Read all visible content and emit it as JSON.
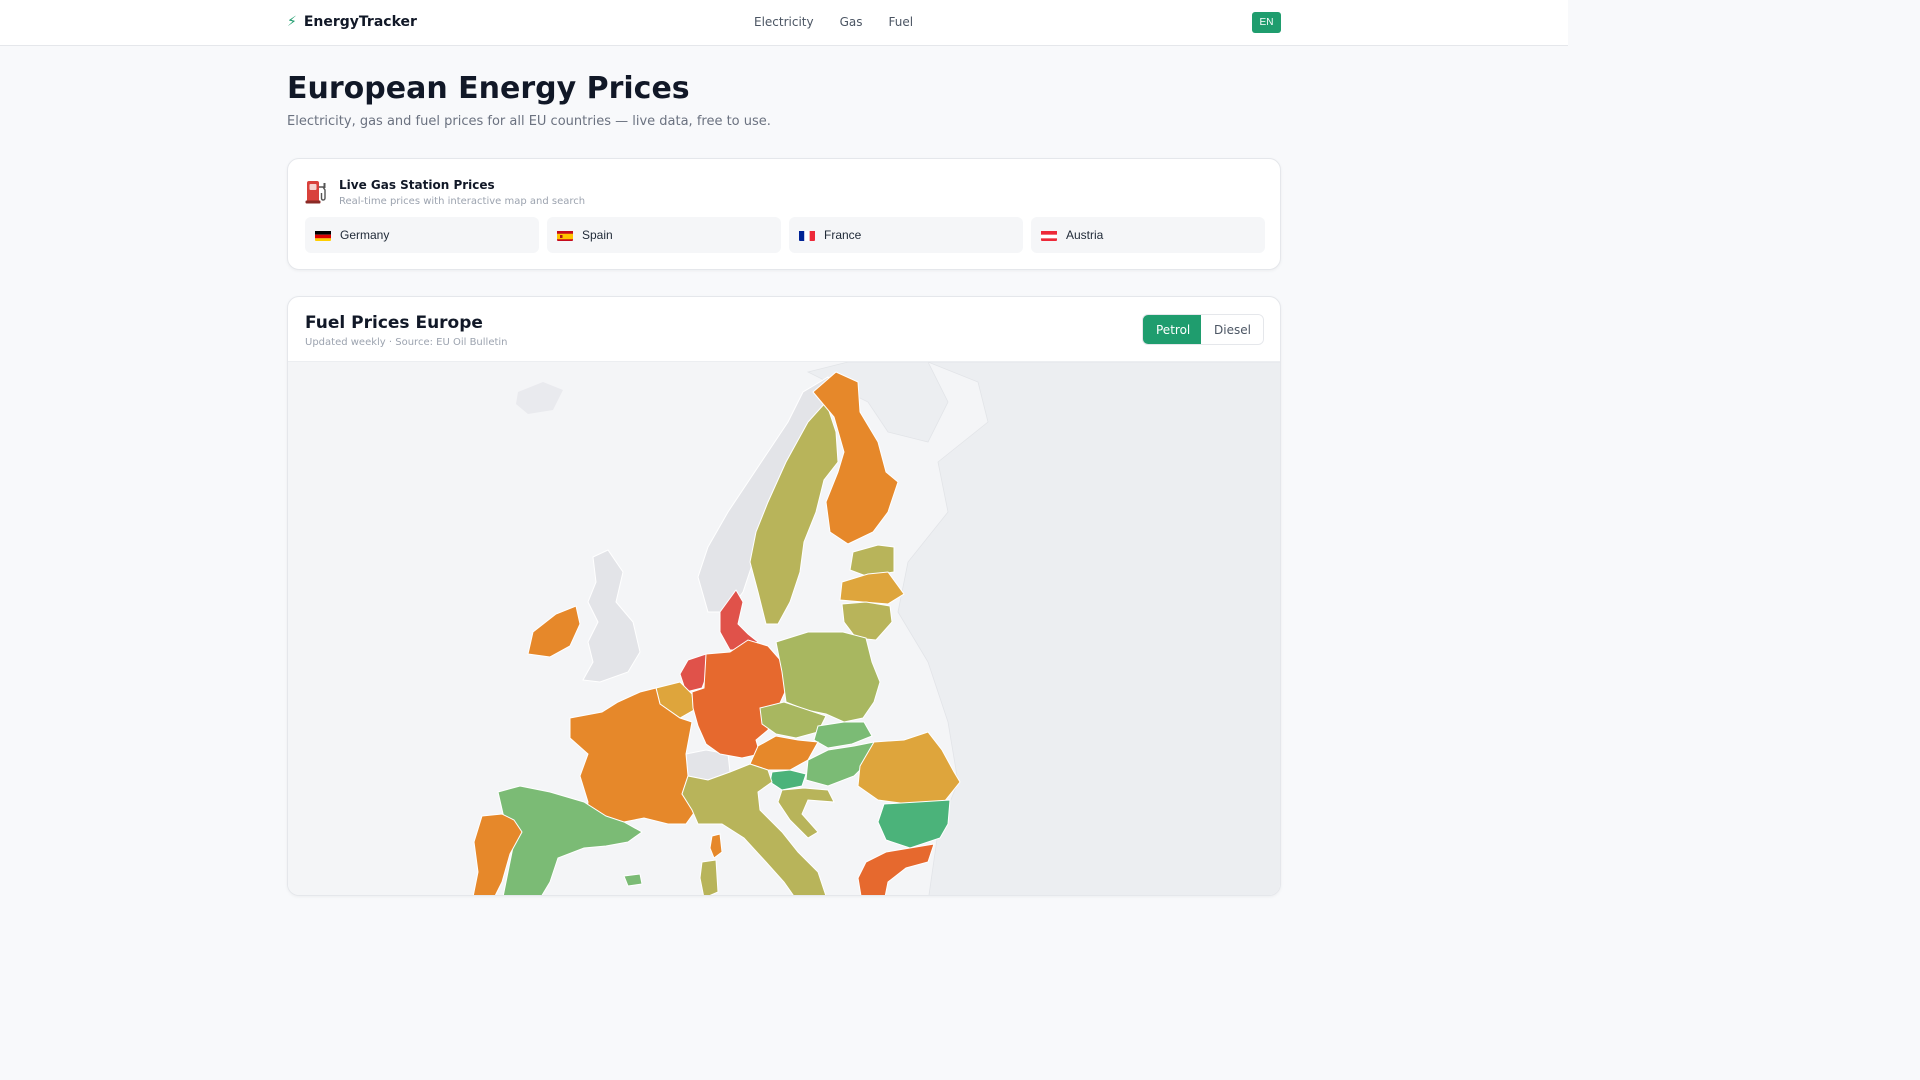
{
  "header": {
    "brand": "EnergyTracker",
    "brand_icon": "lightning-icon",
    "nav": [
      "Electricity",
      "Gas",
      "Fuel"
    ],
    "language": "EN"
  },
  "hero": {
    "title": "European Energy Prices",
    "subtitle": "Electricity, gas and fuel prices for all EU countries — live data, free to use."
  },
  "stations": {
    "icon": "fuel-pump-icon",
    "title": "Live Gas Station Prices",
    "subtitle": "Real-time prices with interactive map and search",
    "countries": [
      {
        "name": "Germany",
        "flag": "de-flag-icon"
      },
      {
        "name": "Spain",
        "flag": "es-flag-icon"
      },
      {
        "name": "France",
        "flag": "fr-flag-icon"
      },
      {
        "name": "Austria",
        "flag": "at-flag-icon"
      }
    ]
  },
  "fuel_map": {
    "title": "Fuel Prices Europe",
    "subtitle": "Updated weekly · Source: EU Oil Bulletin",
    "options": [
      "Petrol",
      "Diesel"
    ],
    "selected": "Petrol",
    "colors": {
      "accent": "#1f9d6e",
      "red": "#e0524a",
      "dark_orange": "#e6692e",
      "orange": "#e6882a",
      "light_orange": "#dea53c",
      "olive": "#b8b45a",
      "light_green": "#a8b760",
      "green": "#7bbb75",
      "dark_green": "#4bb37a",
      "no_data": "#e3e4e8"
    }
  }
}
